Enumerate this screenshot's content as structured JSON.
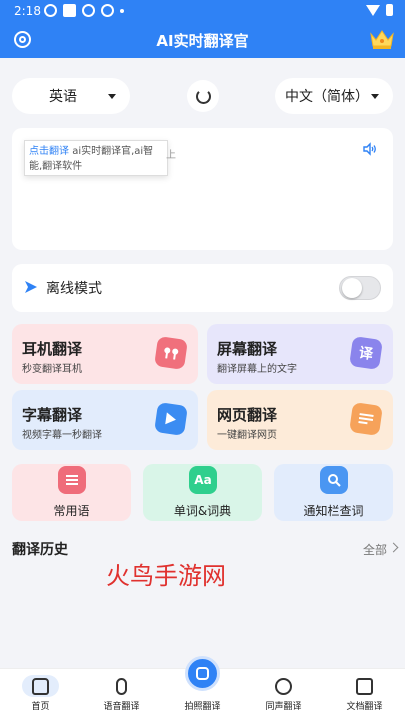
{
  "status_bar": {
    "time": "2:18"
  },
  "app_bar": {
    "title": "AI实时翻译官"
  },
  "languages": {
    "source": "英语",
    "target": "中文（简体）"
  },
  "input": {
    "tooltip_link": "点击翻译",
    "tooltip_text": "ai实时翻译官,ai智能,翻译软件",
    "ghost_char": "上"
  },
  "offline": {
    "label": "离线模式"
  },
  "features": [
    {
      "title": "耳机翻译",
      "subtitle": "秒变翻译耳机",
      "icon": "earbuds-icon",
      "bg": "#fde4e6",
      "icon_color": "#f0707c"
    },
    {
      "title": "屏幕翻译",
      "subtitle": "翻译屏幕上的文字",
      "icon": "translate-icon",
      "bg": "#e7e6fb",
      "icon_color": "#8a84ec",
      "icon_glyph": "译"
    },
    {
      "title": "字幕翻译",
      "subtitle": "视频字幕一秒翻译",
      "icon": "play-icon",
      "bg": "#e2ecfc",
      "icon_color": "#3b8cf2"
    },
    {
      "title": "网页翻译",
      "subtitle": "一键翻译网页",
      "icon": "webpage-icon",
      "bg": "#fdebd9",
      "icon_color": "#f6a25a"
    }
  ],
  "tools": [
    {
      "label": "常用语",
      "icon": "phrases-icon",
      "bg": "#fde4e6",
      "icon_color": "#ef6c7a"
    },
    {
      "label": "单词&词典",
      "icon": "dictionary-icon",
      "bg": "#d9f5e8",
      "icon_color": "#2fcf8d",
      "icon_glyph": "Aa"
    },
    {
      "label": "通知栏查词",
      "icon": "search-icon",
      "bg": "#e2ecfc",
      "icon_color": "#4a96f2"
    }
  ],
  "history": {
    "title": "翻译历史",
    "all": "全部"
  },
  "watermark": "火鸟手游网",
  "nav": [
    {
      "label": "首页",
      "icon": "home-icon"
    },
    {
      "label": "语音翻译",
      "icon": "microphone-icon"
    },
    {
      "label": "拍照翻译",
      "icon": "camera-icon"
    },
    {
      "label": "同声翻译",
      "icon": "simultaneous-icon"
    },
    {
      "label": "文档翻译",
      "icon": "document-icon"
    }
  ],
  "colors": {
    "primary": "#2f82f5",
    "background": "#f3f4f8"
  }
}
